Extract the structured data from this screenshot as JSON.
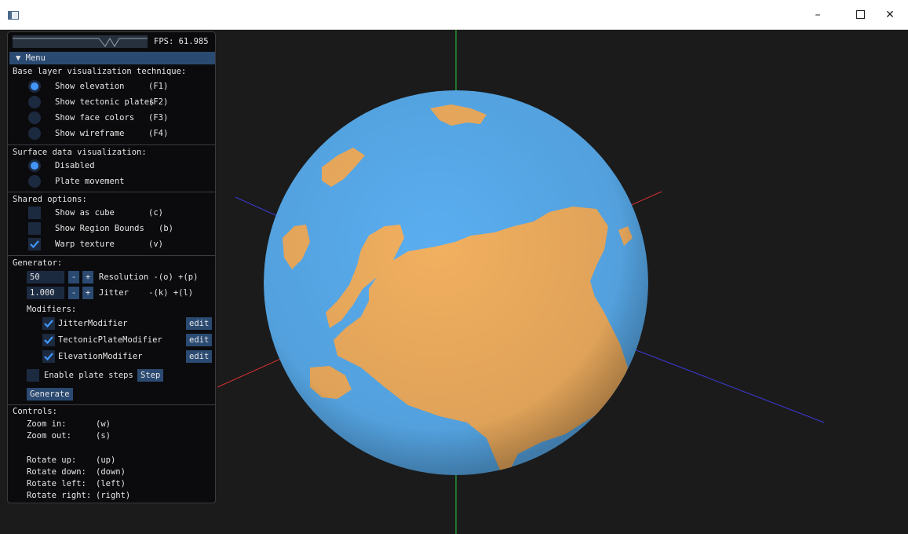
{
  "window": {
    "minimize_label": "–",
    "close_label": "✕",
    "app_icon": "window-app-icon"
  },
  "overlay": {
    "fps_label": "FPS: 61.985",
    "menu_label": "▼ Menu",
    "base_layer": {
      "heading": "Base layer visualization technique:",
      "options": [
        {
          "label": "Show elevation",
          "key": "(F1)",
          "selected": true
        },
        {
          "label": "Show tectonic plates",
          "key": "(F2)",
          "selected": false
        },
        {
          "label": "Show face colors",
          "key": "(F3)",
          "selected": false
        },
        {
          "label": "Show wireframe",
          "key": "(F4)",
          "selected": false
        }
      ]
    },
    "surface": {
      "heading": "Surface data visualization:",
      "options": [
        {
          "label": "Disabled",
          "selected": true
        },
        {
          "label": "Plate movement",
          "selected": false
        }
      ]
    },
    "shared": {
      "heading": "Shared options:",
      "options": [
        {
          "label": "Show as cube",
          "key": "(c)",
          "checked": false
        },
        {
          "label": "Show Region Bounds",
          "key": "(b)",
          "checked": false
        },
        {
          "label": "Warp texture",
          "key": "(v)",
          "checked": true
        }
      ]
    },
    "generator": {
      "heading": "Generator:",
      "resolution_value": "50",
      "resolution_label": "Resolution -(o) +(p)",
      "jitter_value": "1.000",
      "jitter_label": "Jitter    -(k) +(l)",
      "minus": "-",
      "plus": "+",
      "modifiers_heading": "Modifiers:",
      "modifiers": [
        {
          "label": "JitterModifier",
          "checked": true,
          "edit": "edit"
        },
        {
          "label": "TectonicPlateModifier",
          "checked": true,
          "edit": "edit"
        },
        {
          "label": "ElevationModifier",
          "checked": true,
          "edit": "edit"
        }
      ],
      "plate_steps_label": "Enable plate steps",
      "plate_steps_checked": false,
      "step_button": "Step",
      "generate_button": "Generate"
    },
    "controls": {
      "heading": "Controls:",
      "zoom_in": {
        "label": "Zoom in:",
        "key": "(w)"
      },
      "zoom_out": {
        "label": "Zoom out:",
        "key": "(s)"
      },
      "rotate_up": {
        "label": "Rotate up:",
        "key": "(up)"
      },
      "rotate_down": {
        "label": "Rotate down:",
        "key": "(down)"
      },
      "rotate_left": {
        "label": "Rotate left:",
        "key": "(left)"
      },
      "rotate_right": {
        "label": "Rotate right:",
        "key": "(right)"
      }
    }
  },
  "colors": {
    "ocean": "#5aaef0",
    "land": "#f2b060",
    "panel_bg": "#0b0b0d",
    "accent": "#4296fa",
    "button": "#2b4a72"
  }
}
